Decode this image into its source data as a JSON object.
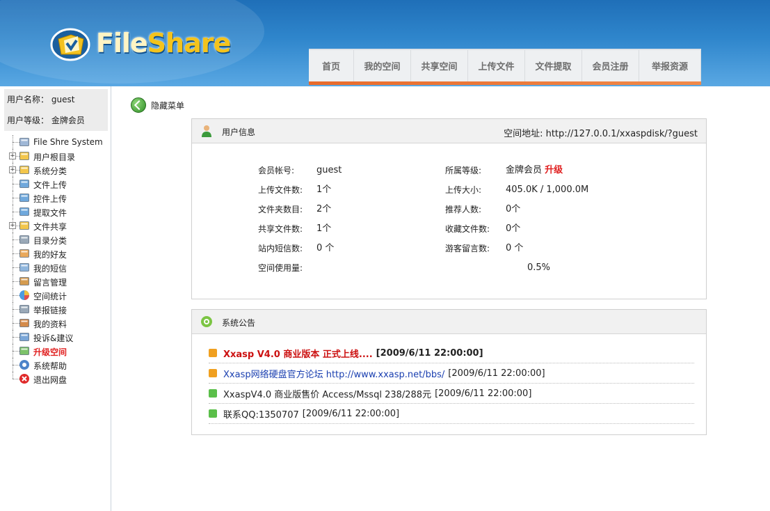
{
  "header": {
    "logo_text_a": "File",
    "logo_text_b": "Share",
    "nav": [
      "首页",
      "我的空间",
      "共享空间",
      "上传文件",
      "文件提取",
      "会员注册",
      "举报资源"
    ]
  },
  "sidebar": {
    "username_label": "用户名称：",
    "username": "guest",
    "level_label": "用户等级：",
    "level": "金牌会员",
    "tree": [
      {
        "label": "File Shre System",
        "icon": "computer-icon",
        "expand": false
      },
      {
        "label": "用户根目录",
        "icon": "user-folder-icon",
        "expand": true
      },
      {
        "label": "系统分类",
        "icon": "category-icon",
        "expand": true
      },
      {
        "label": "文件上传",
        "icon": "upload-icon",
        "expand": false
      },
      {
        "label": "控件上传",
        "icon": "control-upload-icon",
        "expand": false
      },
      {
        "label": "提取文件",
        "icon": "extract-icon",
        "expand": false
      },
      {
        "label": "文件共享",
        "icon": "share-folder-icon",
        "expand": true
      },
      {
        "label": "目录分类",
        "icon": "directory-icon",
        "expand": false
      },
      {
        "label": "我的好友",
        "icon": "friends-icon",
        "expand": false
      },
      {
        "label": "我的短信",
        "icon": "message-icon",
        "expand": false
      },
      {
        "label": "留言管理",
        "icon": "guestbook-icon",
        "expand": false
      },
      {
        "label": "空间统计",
        "icon": "pie-chart-icon",
        "expand": false
      },
      {
        "label": "举报链接",
        "icon": "report-icon",
        "expand": false
      },
      {
        "label": "我的资料",
        "icon": "profile-icon",
        "expand": false
      },
      {
        "label": "投诉&建议",
        "icon": "complaint-icon",
        "expand": false
      },
      {
        "label": "升级空间",
        "icon": "upgrade-icon",
        "expand": false,
        "highlight": true
      },
      {
        "label": "系统帮助",
        "icon": "help-icon",
        "expand": false
      },
      {
        "label": "退出网盘",
        "icon": "exit-icon",
        "expand": false
      }
    ]
  },
  "main": {
    "hide_menu": "隐藏菜单",
    "user_panel": {
      "title": "用户信息",
      "space_address": "空间地址: http://127.0.0.1/xxaspdisk/?guest",
      "rows": [
        {
          "l1": "会员帐号:",
          "v1": "guest",
          "l2": "所属等级:",
          "v2": "金牌会员",
          "upgrade": "升级"
        },
        {
          "l1": "上传文件数:",
          "v1": "1个",
          "l2": "上传大小:",
          "v2": "405.0K / 1,000.0M"
        },
        {
          "l1": "文件夹数目:",
          "v1": "2个",
          "l2": "推荐人数:",
          "v2": "0个"
        },
        {
          "l1": "共享文件数:",
          "v1": "1个",
          "l2": "收藏文件数:",
          "v2": "0个"
        },
        {
          "l1": "站内短信数:",
          "v1": "0 个",
          "l2": "游客留言数:",
          "v2": "0 个"
        }
      ],
      "usage_label": "空间使用量:",
      "usage_value": "0.5%",
      "usage_fraction": 0.005
    },
    "notice_panel": {
      "title": "系统公告",
      "notices": [
        {
          "text": "Xxasp V4.0 商业版本 正式上线....",
          "date": "[2009/6/11 22:00:00]",
          "color": "#cc1111",
          "bold": true,
          "icon_color": "#f0a020"
        },
        {
          "text": "Xxasp网络硬盘官方论坛 http://www.xxasp.net/bbs/",
          "date": "[2009/6/11 22:00:00]",
          "color": "#1a3fb0",
          "bold": false,
          "icon_color": "#f0a020"
        },
        {
          "text": "XxaspV4.0 商业版售价 Access/Mssql 238/288元",
          "date": "[2009/6/11 22:00:00]",
          "color": "#222222",
          "bold": false,
          "icon_color": "#5bbf4a"
        },
        {
          "text": "联系QQ:1350707",
          "date": "[2009/6/11 22:00:00]",
          "color": "#222222",
          "bold": false,
          "icon_color": "#5bbf4a"
        }
      ]
    }
  }
}
